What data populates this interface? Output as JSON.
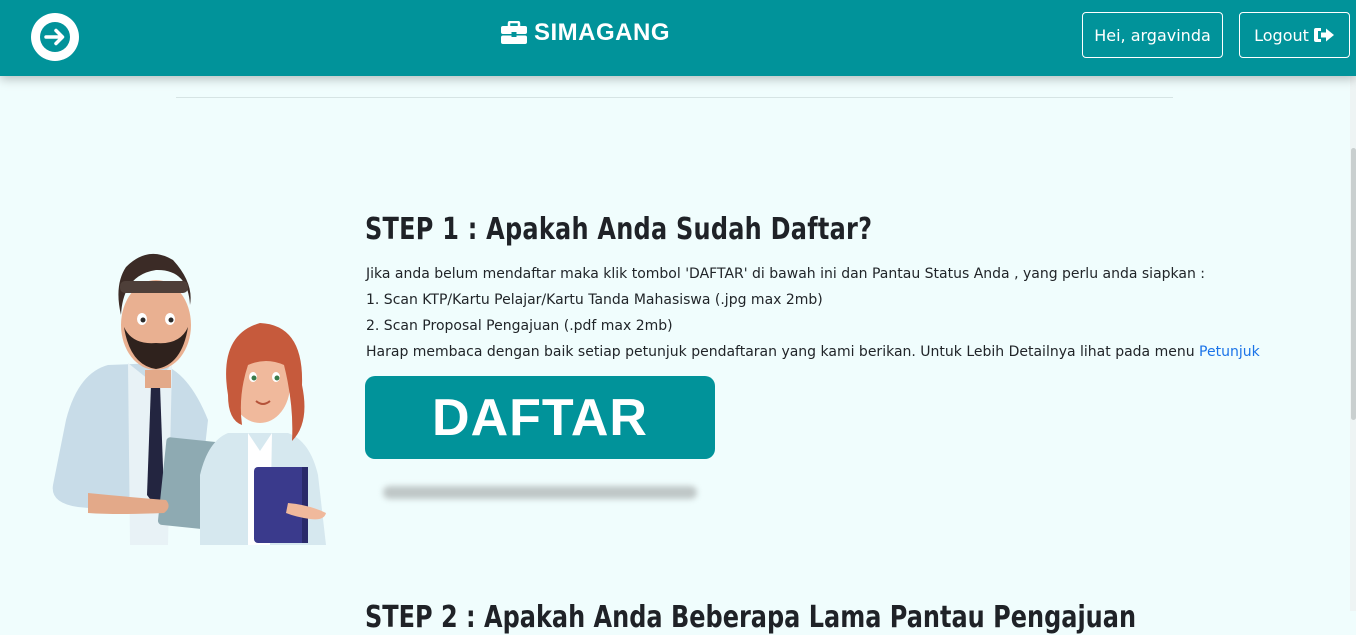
{
  "navbar": {
    "brand": "SIMAGANG",
    "user_label": "Hei, argavinda",
    "logout_label": "Logout",
    "bg_color": "#01939a"
  },
  "icons": {
    "back": "arrow-right-circle-icon",
    "brand": "briefcase-icon",
    "logout": "sign-out-icon"
  },
  "step1": {
    "title": "STEP 1 : Apakah Anda Sudah Daftar?",
    "intro": "Jika anda belum mendaftar maka klik tombol 'DAFTAR' di bawah ini dan Pantau Status Anda , yang perlu anda siapkan :",
    "item1": "1. Scan KTP/Kartu Pelajar/Kartu Tanda Mahasiswa (.jpg max 2mb)",
    "item2": "2. Scan Proposal Pengajuan (.pdf max 2mb)",
    "note": "Harap membaca dengan baik setiap petunjuk pendaftaran yang kami berikan. Untuk Lebih Detailnya lihat pada menu",
    "link": "Petunjuk",
    "button": "DAFTAR"
  },
  "step2": {
    "title": "STEP 2 : Apakah Anda Beberapa Lama Pantau Pengajuan"
  }
}
